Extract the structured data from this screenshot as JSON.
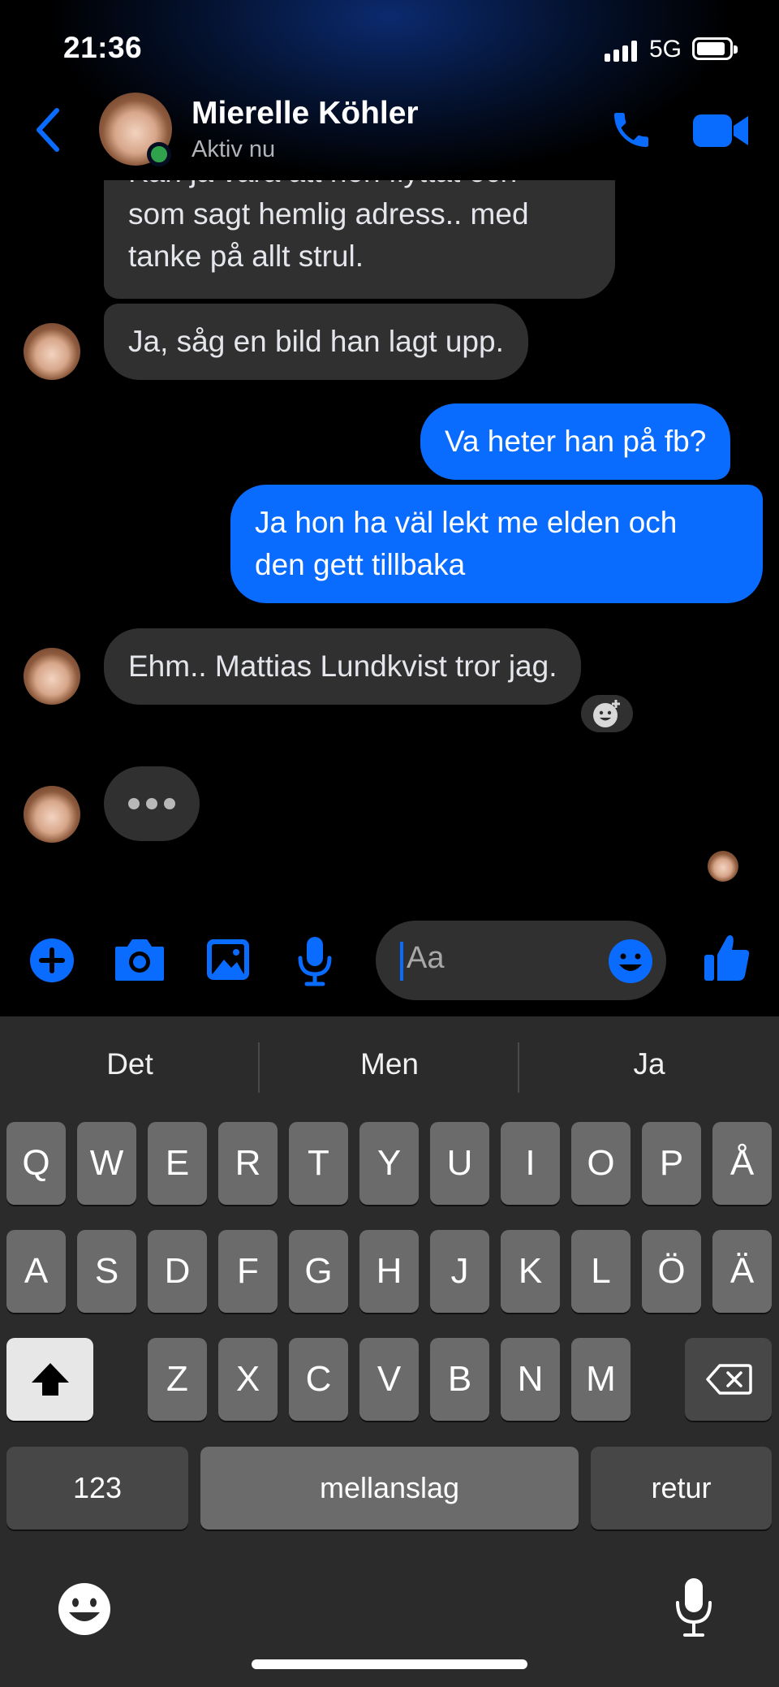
{
  "status_bar": {
    "time": "21:36",
    "network": "5G"
  },
  "header": {
    "contact_name": "Mierelle Köhler",
    "contact_status": "Aktiv nu",
    "icons": [
      "back-chevron-icon",
      "phone-icon",
      "video-camera-icon"
    ],
    "accent_color": "#0a6cff"
  },
  "messages": [
    {
      "direction": "incoming",
      "lines": [
        "Kan ja vara att hon flyttat och",
        "som sagt hemlig adress.. med",
        "tanke på allt strul."
      ]
    },
    {
      "direction": "incoming",
      "lines": [
        "Ja, såg en bild han lagt upp."
      ]
    },
    {
      "direction": "outgoing",
      "lines": [
        "Va heter han på fb?"
      ]
    },
    {
      "direction": "outgoing",
      "lines": [
        "Ja hon ha väl lekt me elden och",
        "den gett tillbaka"
      ]
    },
    {
      "direction": "incoming",
      "lines": [
        "Ehm.. Mattias Lundkvist tror jag."
      ]
    }
  ],
  "composer": {
    "placeholder": "Aa",
    "icons": [
      "plus-icon",
      "camera-icon",
      "gallery-icon",
      "microphone-icon",
      "emoji-icon",
      "thumbs-up-icon"
    ]
  },
  "keyboard": {
    "suggestions": [
      "Det",
      "Men",
      "Ja"
    ],
    "row1": [
      "Q",
      "W",
      "E",
      "R",
      "T",
      "Y",
      "U",
      "I",
      "O",
      "P",
      "Å"
    ],
    "row2": [
      "A",
      "S",
      "D",
      "F",
      "G",
      "H",
      "J",
      "K",
      "L",
      "Ö",
      "Ä"
    ],
    "row3": [
      "Z",
      "X",
      "C",
      "V",
      "B",
      "N",
      "M"
    ],
    "numbers_key": "123",
    "space_key": "mellanslag",
    "return_key": "retur"
  }
}
